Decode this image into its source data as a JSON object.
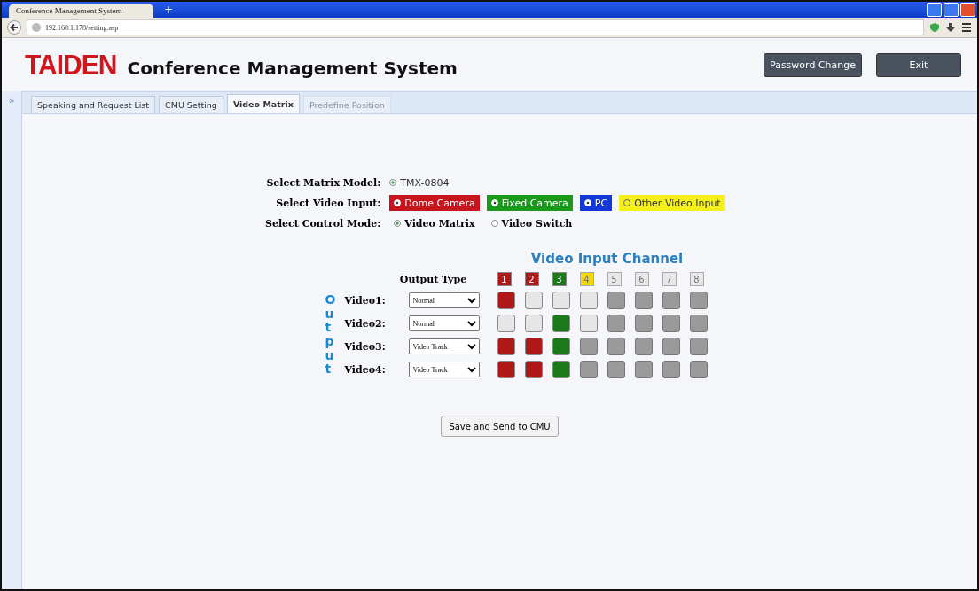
{
  "browser": {
    "tab_title": "Conference Management System",
    "new_tab": "+",
    "address": "192.168.1.178/setting.asp"
  },
  "header": {
    "brand": "TAIDEN",
    "title": "Conference Management System",
    "buttons": [
      "Password Change",
      "Exit"
    ]
  },
  "sidebar": {
    "toggle": "»"
  },
  "tabs": [
    {
      "label": "Speaking and Request List",
      "selected": false,
      "disabled": false
    },
    {
      "label": "CMU Setting",
      "selected": false,
      "disabled": false
    },
    {
      "label": "Video Matrix",
      "selected": true,
      "disabled": false
    },
    {
      "label": "Predefine Position",
      "selected": false,
      "disabled": true
    }
  ],
  "settings": [
    {
      "label": "Select Matrix Model:",
      "kind": "radio",
      "options": [
        {
          "label": "TMX-0804",
          "selected": true
        }
      ]
    },
    {
      "label": "Select Video Input:",
      "kind": "colored",
      "options": [
        {
          "label": "Dome Camera",
          "selected": true,
          "color": "#c8141c"
        },
        {
          "label": "Fixed Camera",
          "selected": true,
          "color": "#1a9a1a"
        },
        {
          "label": "PC",
          "selected": true,
          "color": "#1438d8"
        },
        {
          "label": "Other Video Input",
          "selected": false,
          "color": "#f4f01c"
        }
      ]
    },
    {
      "label": "Select Control Mode:",
      "kind": "radio",
      "options": [
        {
          "label": "Video Matrix",
          "selected": true
        },
        {
          "label": "Video Switch",
          "selected": false
        }
      ]
    }
  ],
  "matrix": {
    "title": "Video Input Channel",
    "output_label": "Output",
    "type_heading": "Output Type",
    "channels": [
      {
        "label": "1",
        "color": "#b01818"
      },
      {
        "label": "2",
        "color": "#b01818"
      },
      {
        "label": "3",
        "color": "#1a7a1a"
      },
      {
        "label": "4",
        "color": "#f0d800"
      },
      {
        "label": "5",
        "color": "#e8e8e8"
      },
      {
        "label": "6",
        "color": "#e8e8e8"
      },
      {
        "label": "7",
        "color": "#e8e8e8"
      },
      {
        "label": "8",
        "color": "#e8e8e8"
      }
    ],
    "outputs": [
      {
        "label": "Video1:",
        "type": "Normal",
        "cells": [
          {
            "selected": true,
            "disabled": false
          },
          {
            "selected": false,
            "disabled": false
          },
          {
            "selected": false,
            "disabled": false
          },
          {
            "selected": false,
            "disabled": false
          },
          {
            "selected": false,
            "disabled": true
          },
          {
            "selected": false,
            "disabled": true
          },
          {
            "selected": false,
            "disabled": true
          },
          {
            "selected": false,
            "disabled": true
          }
        ]
      },
      {
        "label": "Video2:",
        "type": "Normal",
        "cells": [
          {
            "selected": false,
            "disabled": false
          },
          {
            "selected": false,
            "disabled": false
          },
          {
            "selected": true,
            "disabled": false
          },
          {
            "selected": false,
            "disabled": false
          },
          {
            "selected": false,
            "disabled": true
          },
          {
            "selected": false,
            "disabled": true
          },
          {
            "selected": false,
            "disabled": true
          },
          {
            "selected": false,
            "disabled": true
          }
        ]
      },
      {
        "label": "Video3:",
        "type": "Video Track",
        "cells": [
          {
            "selected": true,
            "disabled": false
          },
          {
            "selected": true,
            "disabled": false
          },
          {
            "selected": true,
            "disabled": false
          },
          {
            "selected": false,
            "disabled": true
          },
          {
            "selected": false,
            "disabled": true
          },
          {
            "selected": false,
            "disabled": true
          },
          {
            "selected": false,
            "disabled": true
          },
          {
            "selected": false,
            "disabled": true
          }
        ]
      },
      {
        "label": "Video4:",
        "type": "Video Track",
        "cells": [
          {
            "selected": true,
            "disabled": false
          },
          {
            "selected": true,
            "disabled": false
          },
          {
            "selected": true,
            "disabled": false
          },
          {
            "selected": false,
            "disabled": true
          },
          {
            "selected": false,
            "disabled": true
          },
          {
            "selected": false,
            "disabled": true
          },
          {
            "selected": false,
            "disabled": true
          },
          {
            "selected": false,
            "disabled": true
          }
        ]
      }
    ]
  },
  "save_button": "Save and Send to CMU"
}
